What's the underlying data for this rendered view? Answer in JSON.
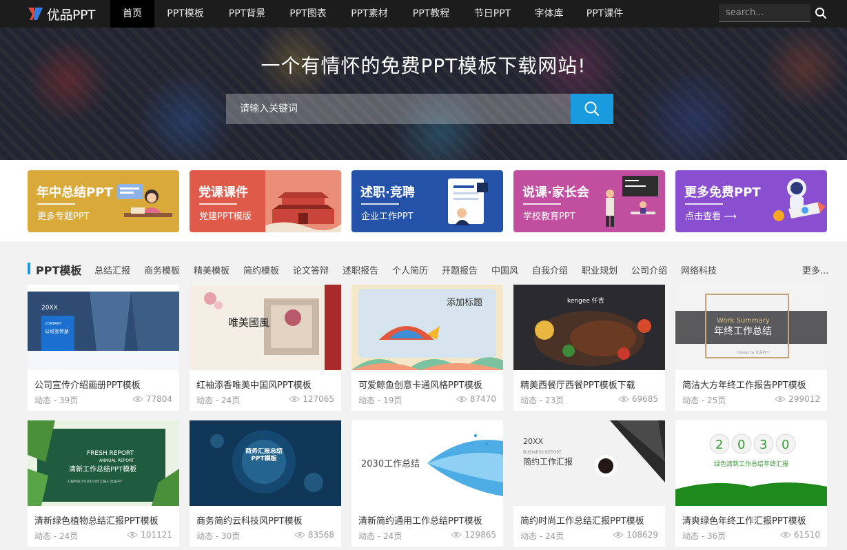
{
  "logo": {
    "text": "优品PPT"
  },
  "nav": {
    "items": [
      {
        "label": "首页",
        "active": true
      },
      {
        "label": "PPT模板"
      },
      {
        "label": "PPT背景"
      },
      {
        "label": "PPT图表"
      },
      {
        "label": "PPT素材"
      },
      {
        "label": "PPT教程"
      },
      {
        "label": "节日PPT"
      },
      {
        "label": "字体库"
      },
      {
        "label": "PPT课件"
      }
    ],
    "search_placeholder": "search..."
  },
  "hero": {
    "title": "一个有情怀的免费PPT模板下载网站!",
    "search_placeholder": "请输入关键词",
    "accent": "#1a9be0"
  },
  "banners": [
    {
      "title": "年中总结PPT",
      "sub": "更多专题PPT",
      "color": "#d9a93a"
    },
    {
      "title": "党课课件",
      "sub": "党建PPT模版",
      "color": "#e05a4a"
    },
    {
      "title": "述职·竞聘",
      "sub": "企业工作PPT",
      "color": "#2452a8"
    },
    {
      "title": "说课·家长会",
      "sub": "学校教育PPT",
      "color": "#c24ea0"
    },
    {
      "title": "更多免费PPT",
      "sub": "点击查看 ⟶",
      "color": "#8a4fd0"
    }
  ],
  "section": {
    "title": "PPT模板",
    "tabs": [
      "总结汇报",
      "商务模板",
      "精美模板",
      "简约模板",
      "论文答辩",
      "述职报告",
      "个人简历",
      "开题报告",
      "中国风",
      "自我介绍",
      "职业规划",
      "公司介绍",
      "网络科技"
    ],
    "more": "更多..."
  },
  "cards": [
    {
      "title": "公司宣传介绍画册PPT模板",
      "meta": "动态 - 39页",
      "views": "77804"
    },
    {
      "title": "红袖添香唯美中国风PPT模板",
      "meta": "动态 - 24页",
      "views": "127065"
    },
    {
      "title": "可爱鲸鱼创意卡通风格PPT模板",
      "meta": "动态 - 19页",
      "views": "87470"
    },
    {
      "title": "精美西餐厅西餐PPT模板下载",
      "meta": "动态 - 23页",
      "views": "69685"
    },
    {
      "title": "简洁大方年终工作报告PPT模板",
      "meta": "动态 - 25页",
      "views": "299012"
    },
    {
      "title": "清新绿色植物总结汇报PPT模板",
      "meta": "动态 - 24页",
      "views": "101121"
    },
    {
      "title": "商务简约云科技风PPT模板",
      "meta": "动态 - 30页",
      "views": "83568"
    },
    {
      "title": "清新简约通用工作总结PPT模板",
      "meta": "动态 - 24页",
      "views": "129865"
    },
    {
      "title": "简约时尚工作总结汇报PPT模板",
      "meta": "动态 - 24页",
      "views": "108629"
    },
    {
      "title": "清爽绿色年终工作汇报PPT模板",
      "meta": "动态 - 36页",
      "views": "61510"
    }
  ],
  "thumb_text": {
    "t1_year": "20XX",
    "t1_company": "COMPANY",
    "t1_name": "公司宣传册",
    "t2_text": "唯美國風",
    "t3_text": "添加标题",
    "t4_brand": "kengee 仟吉",
    "t5_en": "Work Summary",
    "t5_cn": "年终工作总结",
    "t5_by": "Design by 优品PPT",
    "t6_en1": "FRESH REPORT",
    "t6_en2": "ANNUAL REPORT",
    "t6_cn": "清新工作总结PPT模板",
    "t6_sub": "汇报时间:2018年10月  汇报人:优品PPT",
    "t7_text": "商务汇报总结PPT模板",
    "t8_text": "2030工作总结",
    "t9_year": "20XX",
    "t9_en": "BUSINESS REPORT",
    "t9_cn": "简约工作汇报",
    "t10_digits": [
      "2",
      "0",
      "3",
      "0"
    ],
    "t10_cn": "绿色清新工作总结年终汇报"
  }
}
